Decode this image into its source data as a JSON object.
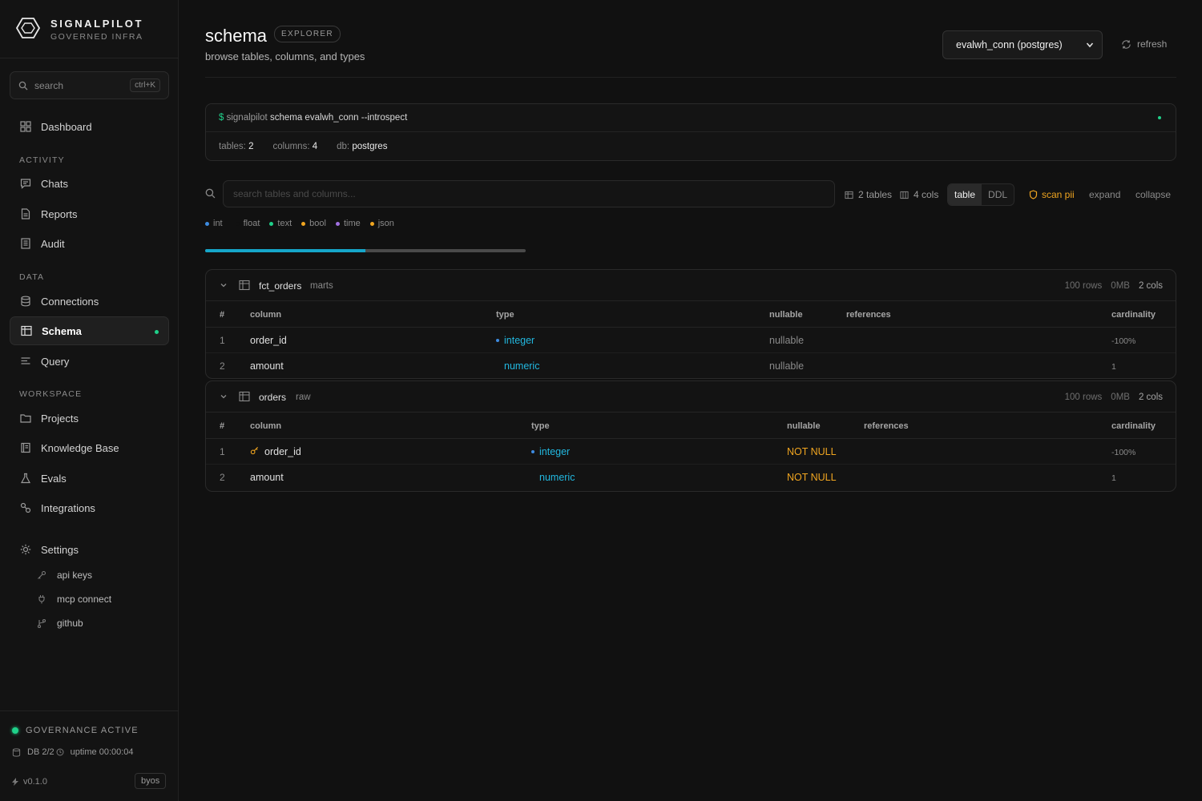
{
  "brand": {
    "name": "SIGNALPILOT",
    "sub": "GOVERNED INFRA"
  },
  "search": {
    "label": "search",
    "shortcut": "ctrl+K"
  },
  "nav": {
    "dashboard": "Dashboard",
    "activity_label": "ACTIVITY",
    "chats": "Chats",
    "reports": "Reports",
    "audit": "Audit",
    "data_label": "DATA",
    "connections": "Connections",
    "schema": "Schema",
    "query": "Query",
    "workspace_label": "WORKSPACE",
    "projects": "Projects",
    "knowledge_base": "Knowledge Base",
    "evals": "Evals",
    "integrations": "Integrations",
    "settings": "Settings",
    "settings_sub": [
      "api keys",
      "mcp connect",
      "github"
    ]
  },
  "status": {
    "governance": "GOVERNANCE ACTIVE",
    "db": "DB 2/2",
    "uptime": "uptime 00:00:04",
    "version": "v0.1.0",
    "byos": "byos"
  },
  "header": {
    "title": "schema",
    "badge": "EXPLORER",
    "subtitle": "browse tables, columns, and types",
    "connection": "evalwh_conn (postgres)",
    "refresh": "refresh"
  },
  "cli": {
    "dollar": "$",
    "prog": "signalpilot",
    "cmd": "schema evalwh_conn --introspect",
    "tables_label": "tables:",
    "tables_val": "2",
    "columns_label": "columns:",
    "columns_val": "4",
    "db_label": "db:",
    "db_val": "postgres"
  },
  "toolbar": {
    "filter_placeholder": "search tables and columns...",
    "tables_count": "2 tables",
    "cols_count": "4 cols",
    "view_table": "table",
    "view_ddl": "DDL",
    "scan_pii": "scan pii",
    "expand": "expand",
    "collapse": "collapse"
  },
  "legend": [
    {
      "label": "int",
      "color": "#3d8be0"
    },
    {
      "label": "float",
      "color": "#111111"
    },
    {
      "label": "text",
      "color": "#1fd18a"
    },
    {
      "label": "bool",
      "color": "#f0a520"
    },
    {
      "label": "time",
      "color": "#a070e0"
    },
    {
      "label": "json",
      "color": "#f0a520"
    }
  ],
  "progress": {
    "fraction": 0.5
  },
  "colhdr": {
    "num": "#",
    "column": "column",
    "type": "type",
    "nullable": "nullable",
    "references": "references",
    "cardinality": "cardinality"
  },
  "tables": [
    {
      "name": "fct_orders",
      "schema": "marts",
      "rows": "100 rows",
      "size": "0MB",
      "cols": "2 cols",
      "columns": [
        {
          "num": "1",
          "name": "order_id",
          "type": "integer",
          "nullable": "nullable",
          "cardinality": "-100%"
        },
        {
          "num": "2",
          "name": "amount",
          "type": "numeric",
          "nullable": "nullable",
          "cardinality": "1"
        }
      ]
    },
    {
      "name": "orders",
      "schema": "raw",
      "rows": "100 rows",
      "size": "0MB",
      "cols": "2 cols",
      "columns": [
        {
          "num": "1",
          "name": "order_id",
          "type": "integer",
          "nullable": "NOT NULL",
          "cardinality": "-100%"
        },
        {
          "num": "2",
          "name": "amount",
          "type": "numeric",
          "nullable": "NOT NULL",
          "cardinality": "1"
        }
      ]
    }
  ]
}
